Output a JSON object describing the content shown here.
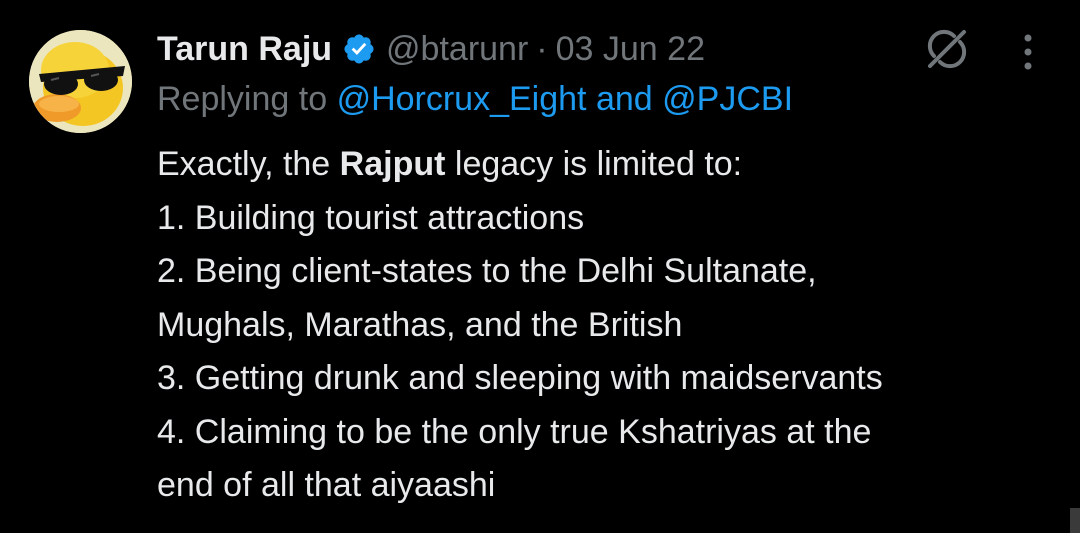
{
  "tweet": {
    "author_name": "Tarun Raju",
    "handle": "@btarunr",
    "separator": "·",
    "date": "03 Jun 22",
    "reply_prefix": "Replying to",
    "reply_mention_1": "@Horcrux_Eight",
    "reply_and": "and",
    "reply_mention_2": "@PJCBI",
    "body": {
      "line1_pre": "Exactly, the ",
      "line1_bold": "Rajput",
      "line1_post": " legacy is limited to:",
      "line2": "1. Building tourist attractions",
      "line3": "2. Being client-states to the Delhi Sultanate,",
      "line4": "Mughals, Marathas, and the British",
      "line5": "3. Getting drunk and sleeping with maidservants",
      "line6": "4. Claiming to be the only true Kshatriyas at the",
      "line7": "end of all that aiyaashi"
    }
  },
  "icons": {
    "avatar": "duck-with-sunglasses-avatar",
    "verified": "verified-badge-icon",
    "grok": "grok-icon",
    "more": "more-vertical-icon"
  },
  "colors": {
    "background": "#000000",
    "text_primary": "#e7e9ea",
    "text_secondary": "#71767b",
    "accent": "#1d9bf0"
  }
}
